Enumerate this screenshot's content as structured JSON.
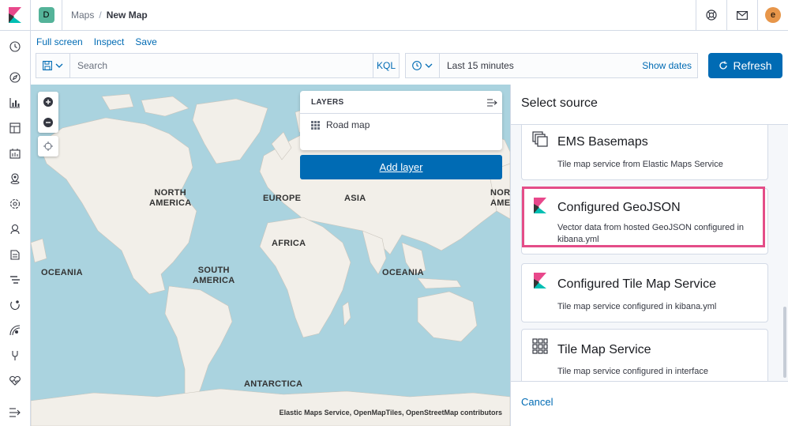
{
  "header": {
    "space_initial": "D",
    "breadcrumbs": [
      "Maps",
      "New Map"
    ],
    "user_initial": "e"
  },
  "top_links": {
    "full_screen": "Full screen",
    "inspect": "Inspect",
    "save": "Save"
  },
  "query": {
    "search_placeholder": "Search",
    "language": "KQL",
    "date_range": "Last 15 minutes",
    "show_dates": "Show dates",
    "refresh": "Refresh"
  },
  "map": {
    "labels": {
      "north_america": "NORTH\nAMERICA",
      "europe": "EUROPE",
      "asia": "ASIA",
      "north_america_right": "NOR\nAMER",
      "africa": "AFRICA",
      "oceania_left": "OCEANIA",
      "south_america": "SOUTH\nAMERICA",
      "oceania_right": "OCEANIA",
      "antarctica": "ANTARCTICA"
    },
    "attribution": "Elastic Maps Service, OpenMapTiles, OpenStreetMap contributors",
    "layers_title": "LAYERS",
    "layers": [
      {
        "name": "Road map"
      }
    ],
    "add_layer": "Add layer"
  },
  "source_panel": {
    "title": "Select source",
    "cards": [
      {
        "title": "EMS Basemaps",
        "desc": "Tile map service from Elastic Maps Service",
        "icon": "ems-basemaps-icon"
      },
      {
        "title": "Configured GeoJSON",
        "desc": "Vector data from hosted GeoJSON configured in kibana.yml",
        "icon": "kibana-icon",
        "highlighted": true
      },
      {
        "title": "Configured Tile Map Service",
        "desc": "Tile map service configured in kibana.yml",
        "icon": "kibana-icon"
      },
      {
        "title": "Tile Map Service",
        "desc": "Tile map service configured in interface",
        "icon": "grid-icon"
      }
    ],
    "cancel": "Cancel"
  },
  "colors": {
    "accent": "#006bb4",
    "highlight": "#e44d88",
    "water": "#aad3df",
    "land": "#f2efe9"
  }
}
